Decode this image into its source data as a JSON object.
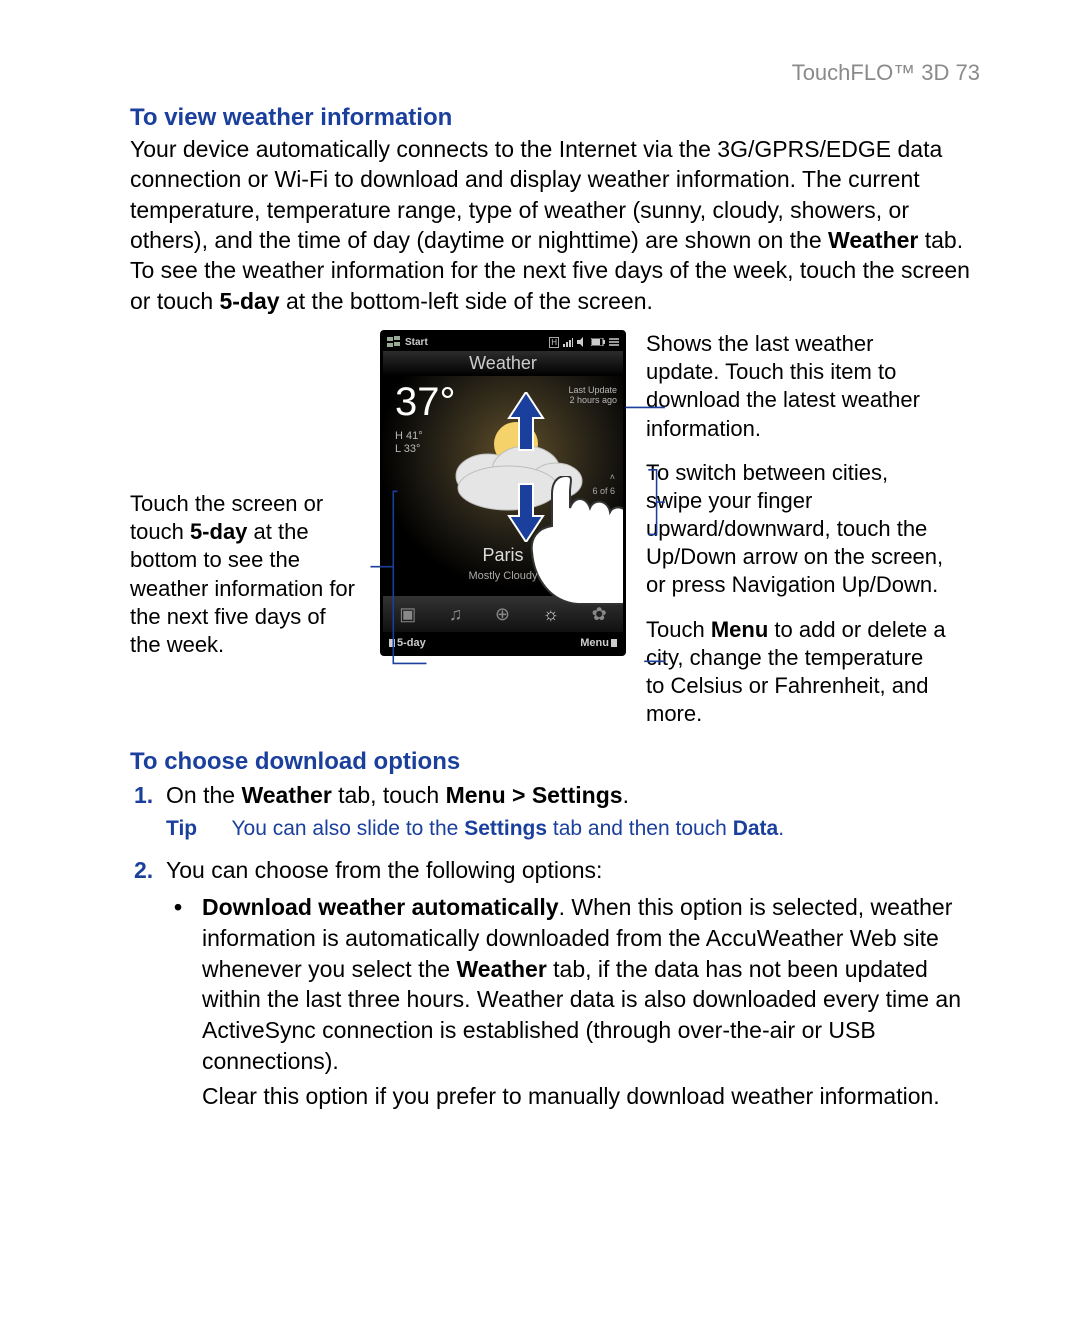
{
  "page_header": "TouchFLO™ 3D  73",
  "section1": {
    "heading": "To view weather information",
    "body_parts": [
      "Your device automatically connects to the Internet via the 3G/GPRS/EDGE data connection or Wi-Fi to download and display weather information. The current temperature, temperature range, type of weather (sunny, cloudy, showers, or others), and the time of day (daytime or nighttime) are shown on the ",
      "Weather",
      " tab. To see the weather information for the next five days of the week, touch the screen or touch ",
      "5-day",
      " at the bottom-left side of the screen."
    ]
  },
  "callouts": {
    "left_1_parts": [
      "Touch the screen or touch ",
      "5-day",
      " at the bottom to see the weather information for the next five days of the week."
    ],
    "right_1": "Shows the last weather update. Touch this item to download the latest weather information.",
    "right_2": "To switch between cities, swipe your finger upward/downward, touch the Up/Down arrow on the screen, or press Navigation Up/Down.",
    "right_3_parts": [
      "Touch ",
      "Menu",
      " to add or delete a city, change the temperature to Celsius or Fahrenheit, and more."
    ]
  },
  "phone": {
    "start": "Start",
    "title": "Weather",
    "temp": "37°",
    "temp_hi_label": "H",
    "temp_hi": "41°",
    "temp_lo_label": "L",
    "temp_lo": "33°",
    "last_update_label": "Last Update",
    "last_update_value": "2 hours ago",
    "counter": "6 of 6",
    "up_caret": "˄",
    "city": "Paris",
    "condition": "Mostly Cloudy",
    "softkey_left": "5-day",
    "softkey_right": "Menu",
    "tab_icons": [
      "camera-icon",
      "music-icon",
      "globe-icon",
      "settings-sun-icon",
      "gear-icon"
    ]
  },
  "section2": {
    "heading": "To choose download options",
    "step1_parts": [
      "On the ",
      "Weather",
      " tab, touch ",
      "Menu > Settings",
      "."
    ],
    "tip_label": "Tip",
    "tip_parts": [
      "You can also slide to the ",
      "Settings",
      " tab and then touch ",
      "Data",
      "."
    ],
    "step2": "You can choose from the following options:",
    "bullet1_parts": [
      "Download weather automatically",
      ". When this option is selected, weather information is automatically downloaded from the AccuWeather Web site whenever you select the ",
      "Weather",
      " tab, if the data has not been updated within the last three hours. Weather data is also downloaded every time an ActiveSync connection is established (through over-the-air or USB connections)."
    ],
    "bullet1_trail": "Clear this option if you prefer to manually download weather information."
  }
}
